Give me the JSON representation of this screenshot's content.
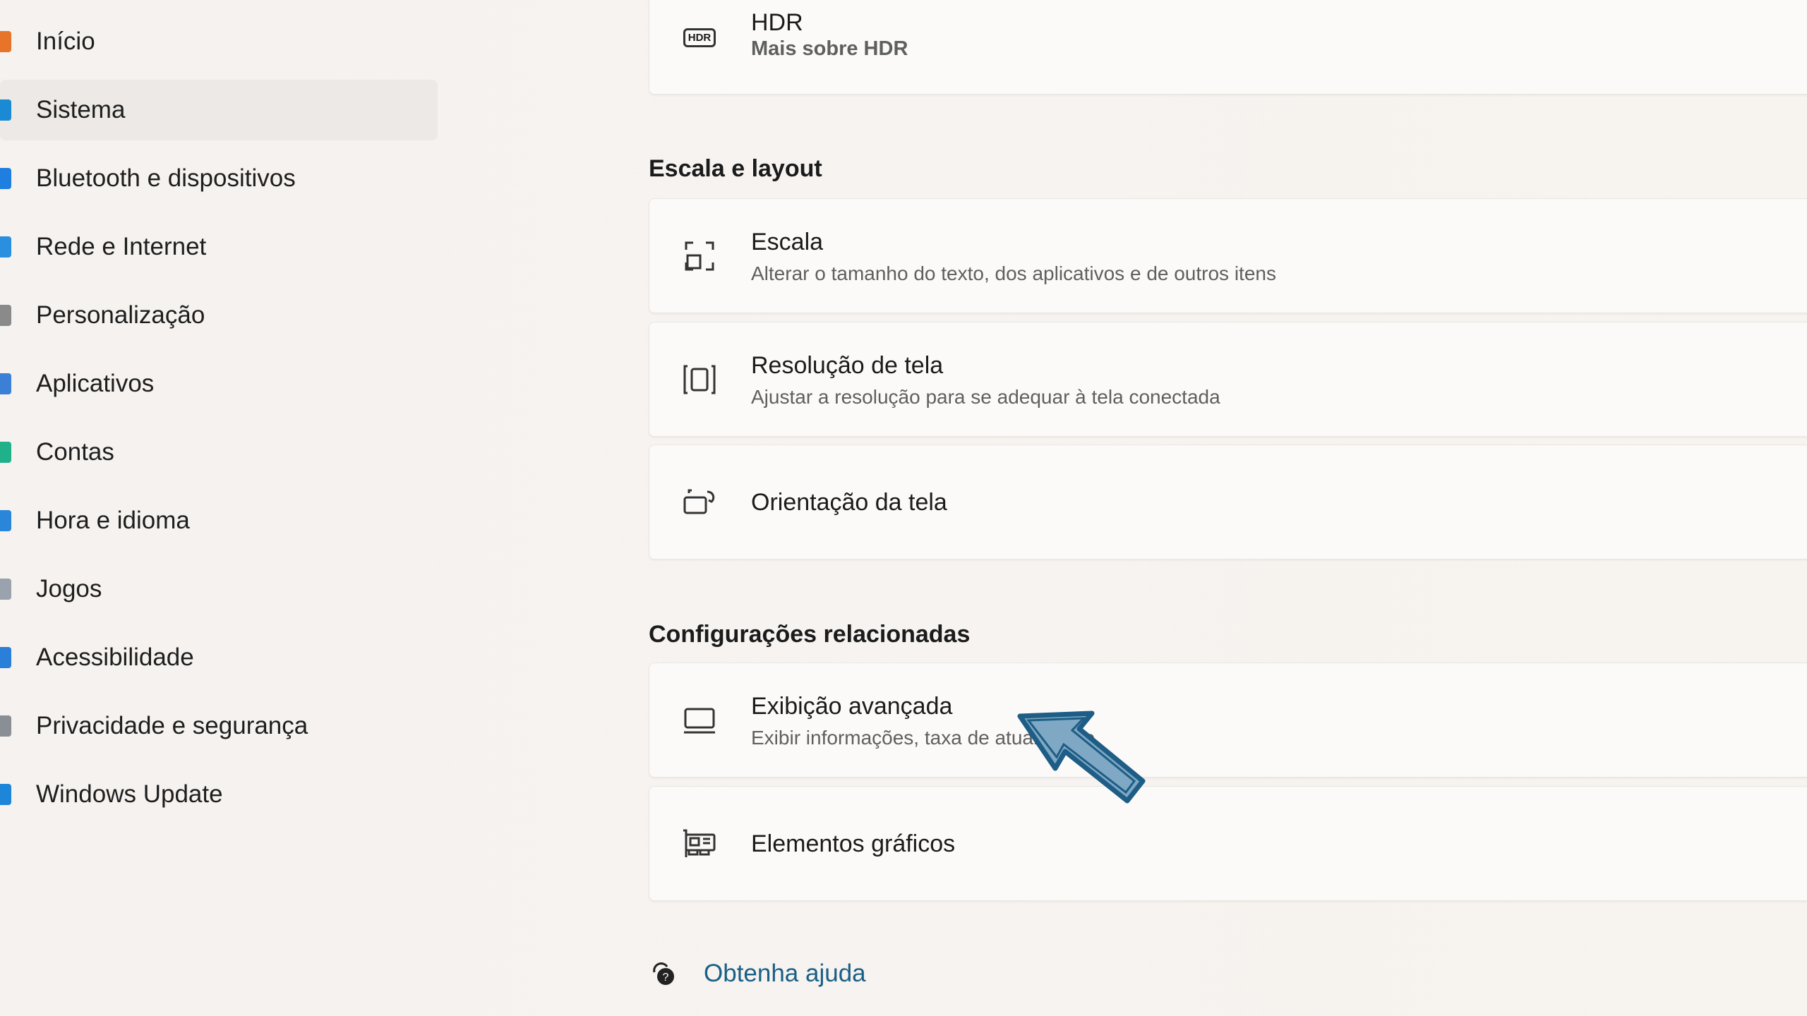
{
  "sidebar": {
    "items": [
      {
        "label": "Início",
        "icon": "home-icon",
        "color": "#e8742a"
      },
      {
        "label": "Sistema",
        "icon": "system-icon",
        "color": "#1a8ad4",
        "selected": true
      },
      {
        "label": "Bluetooth e dispositivos",
        "icon": "bluetooth-icon",
        "color": "#1e7fe0"
      },
      {
        "label": "Rede e Internet",
        "icon": "network-icon",
        "color": "#2b8fe0"
      },
      {
        "label": "Personalização",
        "icon": "personalization-icon",
        "color": "#8a8a8a"
      },
      {
        "label": "Aplicativos",
        "icon": "apps-icon",
        "color": "#3c7fd6"
      },
      {
        "label": "Contas",
        "icon": "accounts-icon",
        "color": "#20b08a"
      },
      {
        "label": "Hora e idioma",
        "icon": "time-language-icon",
        "color": "#2a86d8"
      },
      {
        "label": "Jogos",
        "icon": "gaming-icon",
        "color": "#9aa3ad"
      },
      {
        "label": "Acessibilidade",
        "icon": "accessibility-icon",
        "color": "#2a7fd8"
      },
      {
        "label": "Privacidade e segurança",
        "icon": "privacy-shield-icon",
        "color": "#8a8f96"
      },
      {
        "label": "Windows Update",
        "icon": "windows-update-icon",
        "color": "#1e86d8"
      }
    ]
  },
  "hdr": {
    "title": "HDR",
    "link": "Mais sobre HDR",
    "icon_text": "HDR"
  },
  "scale_section": {
    "title": "Escala e layout",
    "items": [
      {
        "title": "Escala",
        "subtitle": "Alterar o tamanho do texto, dos aplicativos e de outros itens"
      },
      {
        "title": "Resolução de tela",
        "subtitle": "Ajustar a resolução para se adequar à tela conectada"
      },
      {
        "title": "Orientação da tela"
      }
    ]
  },
  "related_section": {
    "title": "Configurações relacionadas",
    "items": [
      {
        "title": "Exibição avançada",
        "subtitle": "Exibir informações, taxa de atualização"
      },
      {
        "title": "Elementos gráficos"
      }
    ]
  },
  "help": {
    "label": "Obtenha ajuda"
  },
  "accent": "#1a5f86"
}
